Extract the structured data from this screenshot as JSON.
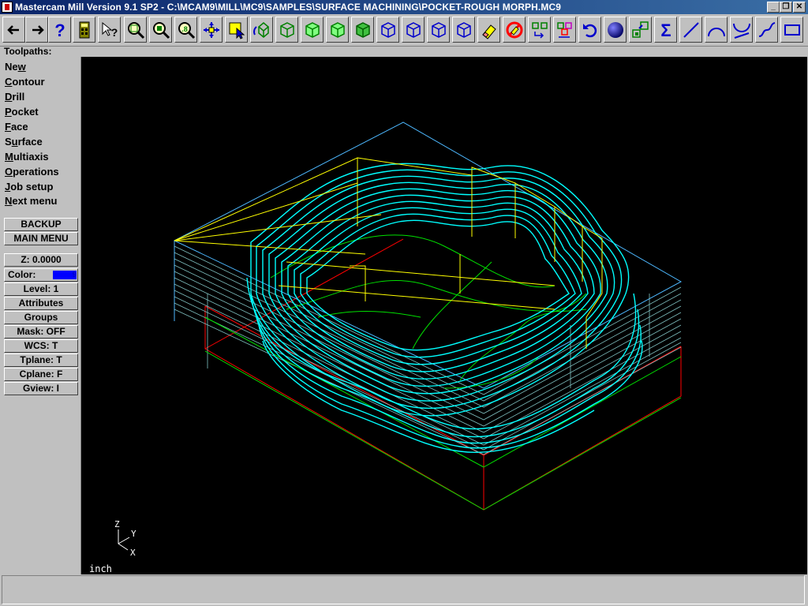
{
  "window": {
    "title": "Mastercam Mill Version 9.1 SP2 - C:\\MCAM9\\MILL\\MC9\\SAMPLES\\SURFACE MACHINING\\POCKET-ROUGH MORPH.MC9",
    "minimize": "_",
    "restore": "❐",
    "close": "✕"
  },
  "toolbar": {
    "icons": [
      "back-arrow-icon",
      "forward-arrow-icon",
      "help-icon",
      "calculator-icon",
      "pointer-help-icon",
      "zoom-window-icon",
      "zoom-unzoom-icon",
      "zoom-scale-icon",
      "pan-icon",
      "select-icon",
      "rotate-icon",
      "cube-view-1-icon",
      "cube-view-2-icon",
      "cube-view-3-icon",
      "cube-view-4-icon",
      "cube-view-5-icon",
      "cube-view-6-icon",
      "cube-view-7-icon",
      "cube-view-8-icon",
      "eraser-icon",
      "no-delete-icon",
      "transform-1-icon",
      "transform-2-icon",
      "undo-icon",
      "sphere-icon",
      "multi-transform-icon",
      "sigma-icon",
      "line-icon",
      "arc-icon",
      "trim-icon",
      "spline-icon",
      "rectangle-icon"
    ]
  },
  "prompt": "Toolpaths:",
  "menu": {
    "items": [
      {
        "pre": "Ne",
        "key": "w",
        "post": ""
      },
      {
        "pre": "",
        "key": "C",
        "post": "ontour"
      },
      {
        "pre": "",
        "key": "D",
        "post": "rill"
      },
      {
        "pre": "",
        "key": "P",
        "post": "ocket"
      },
      {
        "pre": "",
        "key": "F",
        "post": "ace"
      },
      {
        "pre": "S",
        "key": "u",
        "post": "rface"
      },
      {
        "pre": "",
        "key": "M",
        "post": "ultiaxis"
      },
      {
        "pre": "",
        "key": "O",
        "post": "perations"
      },
      {
        "pre": "",
        "key": "J",
        "post": "ob setup"
      },
      {
        "pre": "",
        "key": "N",
        "post": "ext menu"
      }
    ],
    "backup": "BACKUP",
    "main_menu": "MAIN MENU"
  },
  "params": {
    "z": "Z:  0.0000",
    "color_label": "Color:",
    "color_value": "9",
    "level": "Level:  1",
    "attributes": "Attributes",
    "groups": "Groups",
    "mask": "Mask:  OFF",
    "wcs": "WCS:   T",
    "tplane": "Tplane:  T",
    "cplane": "Cplane:  F",
    "gview": "Gview:   I"
  },
  "axes": {
    "z": "Z",
    "y": "Y",
    "x": "X"
  },
  "units": "inch",
  "colors": {
    "toolpath": "#00ffff",
    "boundary": "#ffff00",
    "stock": "#ff0000",
    "surface": "#00ff00",
    "background": "#000000"
  }
}
